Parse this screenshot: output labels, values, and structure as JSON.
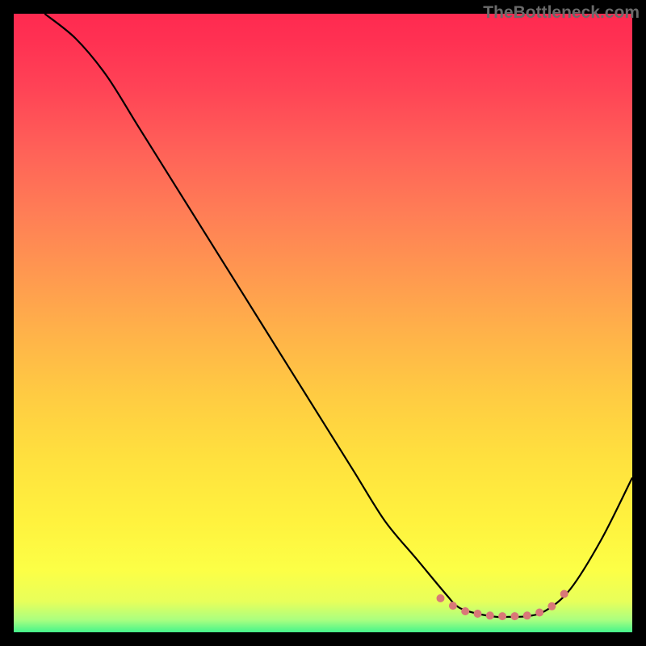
{
  "watermark": "TheBottleneck.com",
  "chart_data": {
    "type": "line",
    "title": "",
    "xlabel": "",
    "ylabel": "",
    "xlim": [
      0,
      100
    ],
    "ylim": [
      0,
      100
    ],
    "grid": false,
    "legend": false,
    "series": [
      {
        "name": "bottleneck-curve",
        "x": [
          5,
          10,
          15,
          20,
          25,
          30,
          35,
          40,
          45,
          50,
          55,
          60,
          65,
          70,
          72,
          75,
          78,
          80,
          83,
          86,
          90,
          95,
          100
        ],
        "y": [
          100,
          96,
          90,
          82,
          74,
          66,
          58,
          50,
          42,
          34,
          26,
          18,
          12,
          6,
          4,
          3,
          2.5,
          2.5,
          2.6,
          3.5,
          7,
          15,
          25
        ]
      }
    ],
    "highlight_points": {
      "x": [
        69,
        71,
        73,
        75,
        77,
        79,
        81,
        83,
        85,
        87,
        89
      ],
      "y": [
        5.5,
        4.3,
        3.4,
        3.0,
        2.7,
        2.6,
        2.6,
        2.7,
        3.2,
        4.2,
        6.2
      ]
    },
    "background": {
      "type": "vertical-gradient",
      "stops": [
        {
          "pos": 0.0,
          "color": "#ff2a50"
        },
        {
          "pos": 0.5,
          "color": "#ffb349"
        },
        {
          "pos": 0.9,
          "color": "#fcff46"
        },
        {
          "pos": 1.0,
          "color": "#44f58b"
        }
      ]
    }
  }
}
